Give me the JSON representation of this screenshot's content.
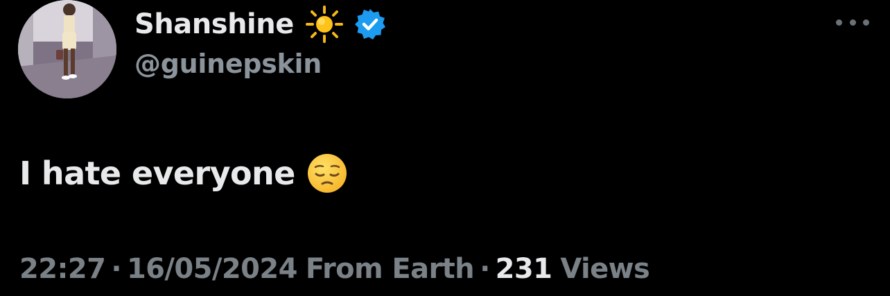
{
  "author": {
    "display_name": "Shanshine",
    "name_emoji": "sun-icon",
    "verified": true,
    "handle": "@guinepskin",
    "avatar": "profile-photo"
  },
  "tweet": {
    "text": "I hate everyone",
    "emoji": "pensive-face-icon"
  },
  "meta": {
    "time": "22:27",
    "separator": "·",
    "date": "16/05/2024",
    "source": "From Earth",
    "views_count": "231",
    "views_label": "Views"
  },
  "colors": {
    "background": "#000000",
    "primary_text": "#e7e9ea",
    "secondary_text": "#7a8187",
    "verified_blue": "#1d9bf0"
  }
}
